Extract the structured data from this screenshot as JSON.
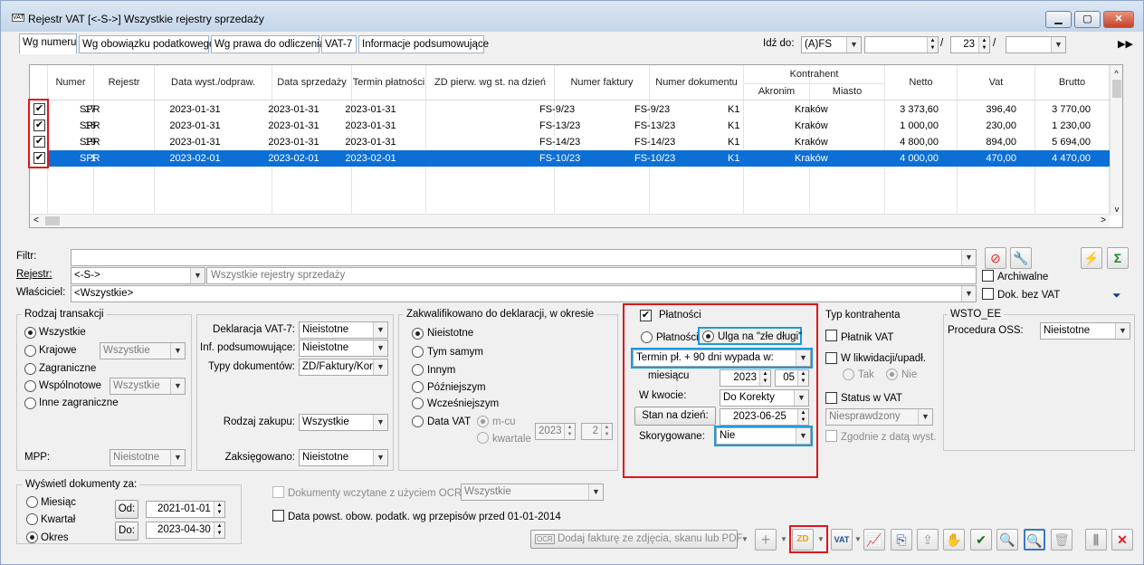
{
  "window": {
    "title": "Rejestr VAT  [<-S->]  Wszystkie rejestry sprzedaży",
    "app_icon": "register-icon",
    "controls": [
      "minimize",
      "maximize",
      "close"
    ]
  },
  "tabs": [
    "Wg numeru",
    "Wg obowiązku podatkowego",
    "Wg prawa do odliczenia",
    "VAT-7",
    "Informacje podsumowujące"
  ],
  "goto": {
    "label": "Idź do:",
    "series": "(A)FS",
    "number": "",
    "month": "23",
    "slash1": "/",
    "slash2": "/",
    "year": ""
  },
  "table": {
    "headers": {
      "numer": "Numer",
      "rejestr": "Rejestr",
      "data_wyst": "Data wyst./odpraw.",
      "data_sprz": "Data sprzedaży",
      "termin": "Termin płatności",
      "zd": "ZD pierw. wg st. na dzień",
      "numer_faktury": "Numer faktury",
      "numer_dok": "Numer dokumentu",
      "kontrahent": "Kontrahent",
      "akronim": "Akronim",
      "miasto": "Miasto",
      "netto": "Netto",
      "vat": "Vat",
      "brutto": "Brutto"
    },
    "rows": [
      {
        "numer": "17",
        "rejestr": "SPR",
        "data_wyst": "2023-01-31",
        "data_sprz": "2023-01-31",
        "termin": "2023-01-31",
        "zd": "",
        "numer_faktury": "FS-9/23",
        "numer_dok": "FS-9/23",
        "akronim": "K1",
        "miasto": "Kraków",
        "netto": "3 373,60",
        "vat": "396,40",
        "brutto": "3 770,00",
        "checked": true,
        "selected": false
      },
      {
        "numer": "18",
        "rejestr": "SPR",
        "data_wyst": "2023-01-31",
        "data_sprz": "2023-01-31",
        "termin": "2023-01-31",
        "zd": "",
        "numer_faktury": "FS-13/23",
        "numer_dok": "FS-13/23",
        "akronim": "K1",
        "miasto": "Kraków",
        "netto": "1 000,00",
        "vat": "230,00",
        "brutto": "1 230,00",
        "checked": true,
        "selected": false
      },
      {
        "numer": "19",
        "rejestr": "SPR",
        "data_wyst": "2023-01-31",
        "data_sprz": "2023-01-31",
        "termin": "2023-01-31",
        "zd": "",
        "numer_faktury": "FS-14/23",
        "numer_dok": "FS-14/23",
        "akronim": "K1",
        "miasto": "Kraków",
        "netto": "4 800,00",
        "vat": "894,00",
        "brutto": "5 694,00",
        "checked": true,
        "selected": false
      },
      {
        "numer": "1",
        "rejestr": "SPR",
        "data_wyst": "2023-02-01",
        "data_sprz": "2023-02-01",
        "termin": "2023-02-01",
        "zd": "",
        "numer_faktury": "FS-10/23",
        "numer_dok": "FS-10/23",
        "akronim": "K1",
        "miasto": "Kraków",
        "netto": "4 000,00",
        "vat": "470,00",
        "brutto": "4 470,00",
        "checked": true,
        "selected": true
      }
    ]
  },
  "filters": {
    "filtr_label": "Filtr:",
    "filtr_value": "",
    "rejestr_label": "Rejestr:",
    "rejestr_value": "<-S->",
    "rejestr_desc": "Wszystkie rejestry sprzedaży",
    "wlasciciel_label": "Właściciel:",
    "wlasciciel_value": "<Wszystkie>",
    "archiwalne": "Archiwalne",
    "dok_bez_vat": "Dok. bez VAT"
  },
  "rodzaj_transakcji": {
    "title": "Rodzaj transakcji",
    "options": [
      "Wszystkie",
      "Krajowe",
      "Zagraniczne",
      "Wspólnotowe",
      "Inne zagraniczne"
    ],
    "krajowe_combo": "Wszystkie",
    "wspolnotowe_combo": "Wszystkie",
    "mpp_label": "MPP:",
    "mpp_value": "Nieistotne"
  },
  "deklaracje": {
    "vat7_label": "Deklaracja VAT-7:",
    "vat7_value": "Nieistotne",
    "inf_label": "Inf. podsumowujące:",
    "inf_value": "Nieistotne",
    "typy_label": "Typy dokumentów:",
    "typy_value": "ZD/Faktury/Kor",
    "zakup_label": "Rodzaj zakupu:",
    "zakup_value": "Wszystkie",
    "zaks_label": "Zaksięgowano:",
    "zaks_value": "Nieistotne"
  },
  "zakwalifikowano": {
    "title": "Zakwalifikowano do deklaracji, w okresie",
    "options": [
      "Nieistotne",
      "Tym samym",
      "Innym",
      "Późniejszym",
      "Wcześniejszym",
      "Data VAT"
    ],
    "mcu": "m-cu",
    "kwartale": "kwartale",
    "year": "2023",
    "month": "2"
  },
  "platnosci": {
    "title": "Płatności",
    "opt1": "Płatności",
    "opt2": "Ulga na \"złe długi\"",
    "termin_combo": "Termin pł. + 90 dni wypada w:",
    "miesiac_label": "miesiącu",
    "year": "2023",
    "month": "05",
    "w_kwocie_label": "W kwocie:",
    "w_kwocie_value": "Do Korekty",
    "stan_button": "Stan na dzień:",
    "stan_date": "2023-06-25",
    "skorygowane_label": "Skorygowane:",
    "skorygowane_value": "Nie"
  },
  "typ_kontrahenta": {
    "title": "Typ kontrahenta",
    "platnik": "Płatnik VAT",
    "likwidacji": "W likwidacji/upadł.",
    "tak": "Tak",
    "nie": "Nie",
    "status": "Status w VAT",
    "status_value": "Niesprawdzony",
    "zgodnie": "Zgodnie z datą wyst."
  },
  "wsto": {
    "title": "WSTO_EE",
    "oss_label": "Procedura OSS:",
    "oss_value": "Nieistotne"
  },
  "wyswietl": {
    "title": "Wyświetl dokumenty za:",
    "options": [
      "Miesiąc",
      "Kwartał",
      "Okres"
    ],
    "od_label": "Od:",
    "od_value": "2021-01-01",
    "do_label": "Do:",
    "do_value": "2023-04-30"
  },
  "ocr": {
    "label": "Dokumenty wczytane z użyciem OCR",
    "value": "Wszystkie",
    "data_powst": "Data powst. obow. podatk. wg przepisów przed 01-01-2014",
    "add_button": "Dodaj fakturę ze zdjęcia, skanu lub PDF"
  },
  "colors": {
    "selection": "#0c6fd5",
    "highlight_red": "#e0141b",
    "highlight_blue": "#1a9be0"
  }
}
